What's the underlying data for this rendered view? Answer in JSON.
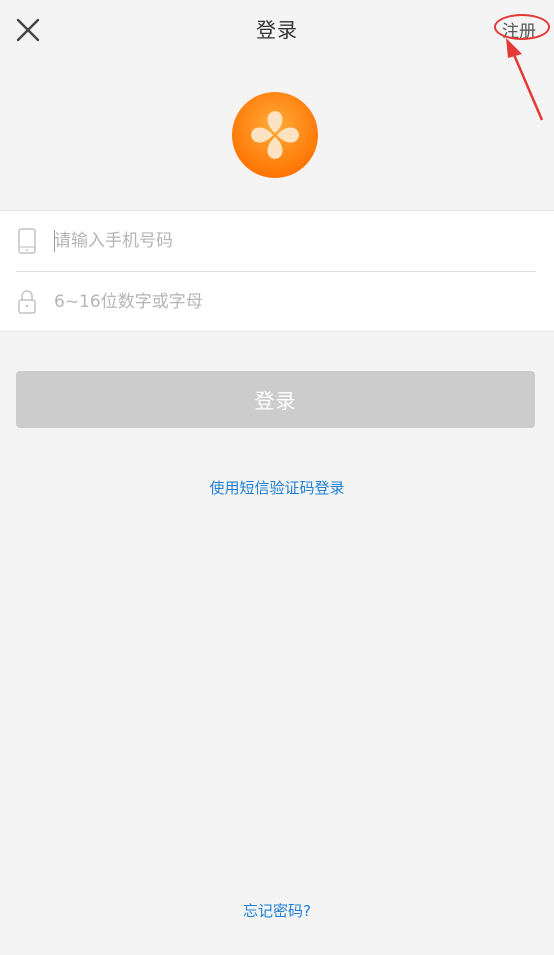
{
  "header": {
    "title": "登录",
    "close_icon": "close-icon",
    "register_label": "注册"
  },
  "logo": {
    "icon": "four-petal-logo-icon",
    "colors": {
      "outer": "#ff7a00",
      "inner": "#ffb347",
      "petal": "#fde3c1"
    }
  },
  "form": {
    "phone": {
      "icon": "phone-icon",
      "placeholder": "请输入手机号码",
      "value": ""
    },
    "password": {
      "icon": "lock-icon",
      "placeholder": "6~16位数字或字母",
      "value": ""
    }
  },
  "login_button": {
    "label": "登录",
    "color": "#cccccc"
  },
  "links": {
    "sms_login": "使用短信验证码登录",
    "forgot_password": "忘记密码?",
    "color": "#1e7fd6"
  },
  "annotation": {
    "color": "#e53935"
  }
}
